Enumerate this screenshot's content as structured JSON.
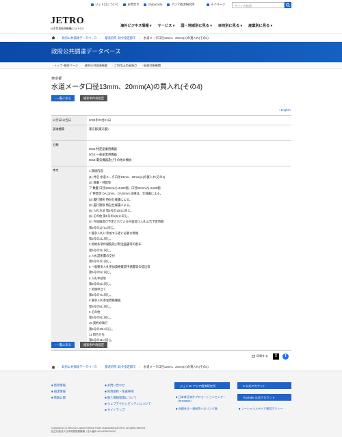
{
  "util": {
    "about": "ジェトロについて",
    "contact": "お問合せ",
    "global": "Global Site",
    "asia": "アジア経済研究所",
    "mypage": "マイページ"
  },
  "search": {
    "placeholder": "サイト内検索"
  },
  "logo": {
    "main": "JETRO",
    "sub": "日本貿易振興機構(ジェトロ)"
  },
  "gnav": [
    "海外ビジネス情報 ▾",
    "サービス ▾",
    "国・地域別に見る ▾",
    "目的別に見る ▾",
    "産業別に見る ▾"
  ],
  "breadcrumb": [
    "政府公共調達データベース",
    "都道府県･政令指定都市",
    "水道メータ口径13mm、20mm(A)の買入れ(その4)"
  ],
  "banner": "政府公共調達データベース",
  "subnav": [
    "トップ･検索ページ",
    "政府公共調達概要",
    "ご利用上の留意点",
    "役務対象機関"
  ],
  "page": {
    "kicker": "東京都",
    "title": "水道メータ口径13mm、20mm(A)の買入れ(その4)",
    "back_btn": "一覧に戻る",
    "cond_btn": "検索条件再指定",
    "english": "English"
  },
  "table": {
    "rows": [
      {
        "label": "公示日/公告日",
        "value": "2024年02月21日"
      },
      {
        "label": "調達機関",
        "value": "東京都(東京都)"
      },
      {
        "label": "分類",
        "lines": [
          "0012 特定産業用機器",
          "0013 一般産業用機器",
          "0016 電気機器及びその他の機械"
        ]
      },
      {
        "label": "本文",
        "lines": [
          "1 調達内容",
          "(1) 件名 水道メータ口径13mm、20mm(A)の買入れ(その4)",
          "(2) 数量・特質等",
          "ア 数量 口径13mm(A) 3,600個、口径20mm(A) 3,600個",
          "イ 特質等 DA13mm、DA20mm 詳細は、仕様書による。",
          "(3) 履行場所 特記仕様書による。",
          "(4) 履行期限 特記仕様書による。",
          "(5) 入札方法 第5号の1(5)に同じ。",
          "(6) その他 第5号の1(6)に同じ。",
          "(7) 今後調達が予定されている内容及び入札公告予定時期",
          "第5号の1(7)に同じ。",
          "2 競争入札に参加する者に必要な資格",
          "第5号の2に同じ。",
          "3 契約条項の縦覧及び発注図書等の配布",
          "第5号の3に同じ。",
          "4 入札説明書の交付",
          "第5号の4に同じ。",
          "5 一般競争入札参加資格確認申請書等の提出等",
          "第5号の5に同じ。",
          "6 入札手続等",
          "第5号の6に同じ。",
          "7 苦情申立て",
          "第5号の7に同じ。",
          "8 競争入札参加資格審査",
          "第5号の8に同じ。",
          "9 その他",
          "第5号の9に同じ。",
          "10 契約の執行",
          "第5号の10に同じ。",
          "11 問合せ先",
          "第5号の11に同じ。"
        ]
      }
    ]
  },
  "share": {
    "print": "印刷する",
    "x": "X",
    "fb": "f"
  },
  "footer": {
    "col1": [
      "貿易情報",
      "調達情報",
      "情報公開"
    ],
    "col2": [
      "お問い合わせ",
      "利用規約・免責事項",
      "個人情報保護について",
      "ウェブアクセシビリティについて",
      "サイトマップ"
    ],
    "asia_btn": "ジェトロ･アジア経済研究所",
    "jfoodo": "日本食品海外プロモーションセンター（JFOODO）",
    "net": "各種合法・規制等へのリンク集",
    "x_btn": "X 公式アカウント",
    "yt_btn": "YouTube 公式アカウント",
    "social": "ソーシャルメディア運用ポリシー",
    "copyright": "Copyright (C) 1995-2024 Japan External Trade Organization(JETRO). All rights reserved.",
    "org": "独立行政法人日本貿易振興機構（法人番号 6010405003434）"
  },
  "colors": {
    "accent": "#1e64c8",
    "banner": "#0a4aa8"
  }
}
